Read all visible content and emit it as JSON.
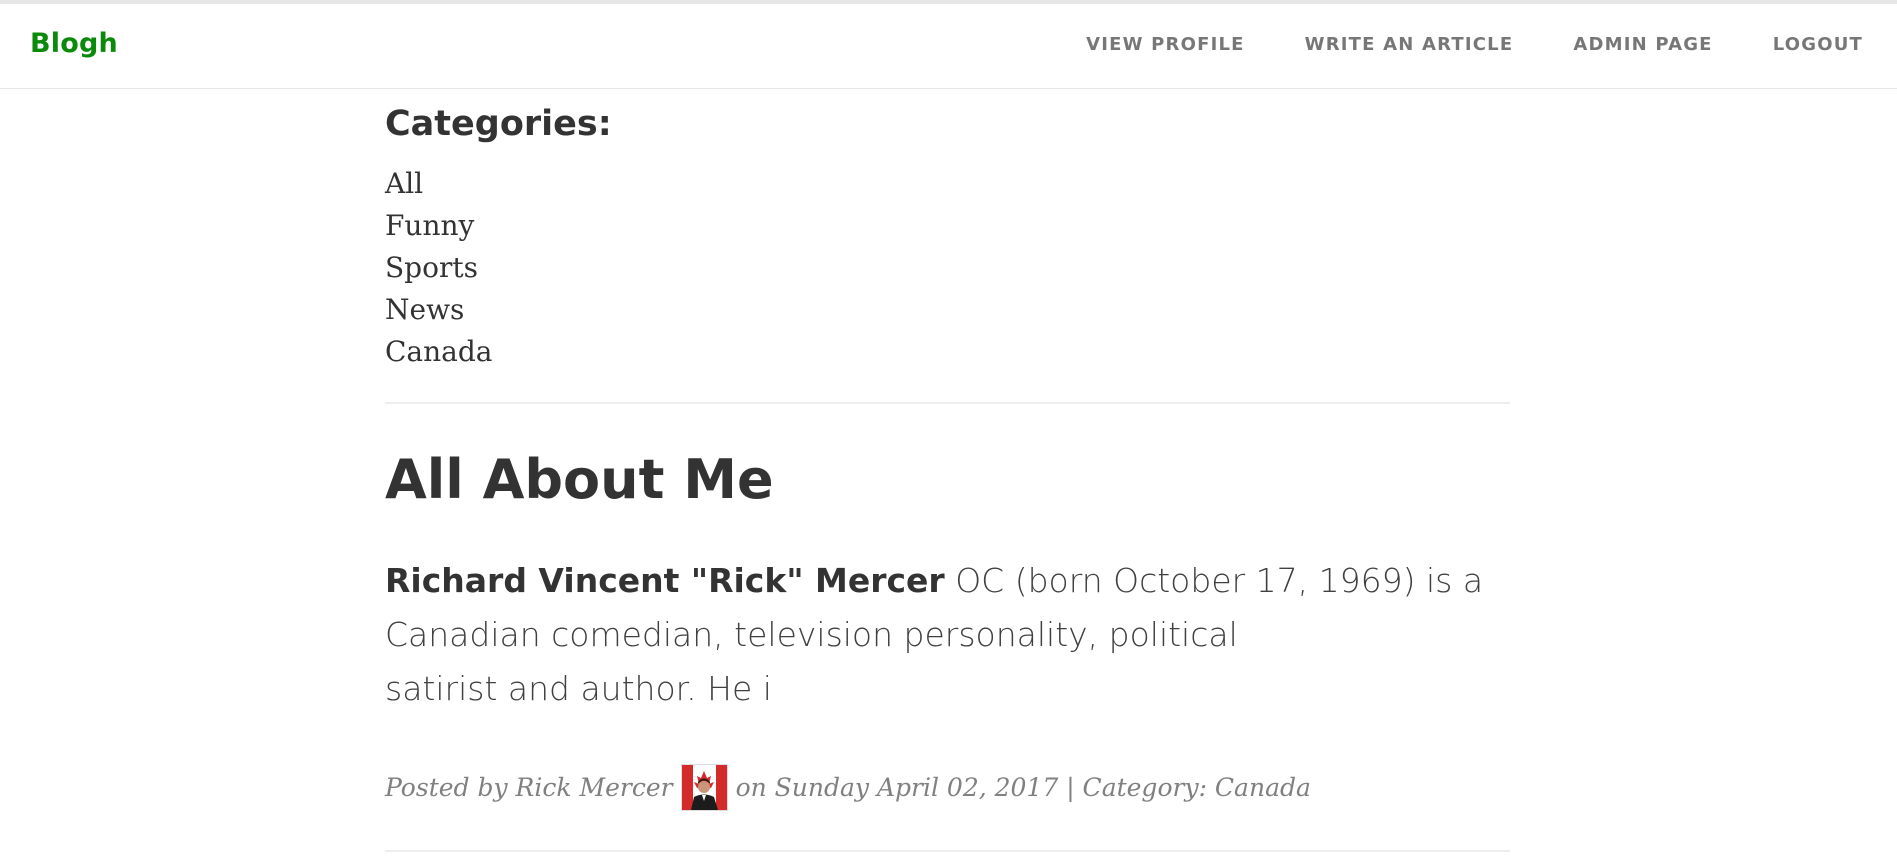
{
  "navbar": {
    "brand": "Blogh",
    "links": [
      "VIEW PROFILE",
      "WRITE AN ARTICLE",
      "ADMIN PAGE",
      "LOGOUT"
    ]
  },
  "sidebar": {
    "heading": "Categories:",
    "items": [
      "All",
      "Funny",
      "Sports",
      "News",
      "Canada"
    ]
  },
  "post": {
    "title": "All About Me",
    "excerpt_bold": "Richard Vincent \"Rick\" Mercer",
    "excerpt_line1_rest": " OC (born October 17, 1969) is a",
    "excerpt_line2": "Canadian comedian, television personality, political",
    "excerpt_line3": "satirist and author. He i",
    "meta_prefix": "Posted by Rick Mercer",
    "meta_suffix": "on Sunday April 02, 2017 | Category: Canada",
    "avatar_icon": "author-avatar-canada-flag"
  },
  "colors": {
    "brand": "#0a8a0a",
    "nav_link": "#777777",
    "text": "#333333",
    "meta": "#808080"
  }
}
